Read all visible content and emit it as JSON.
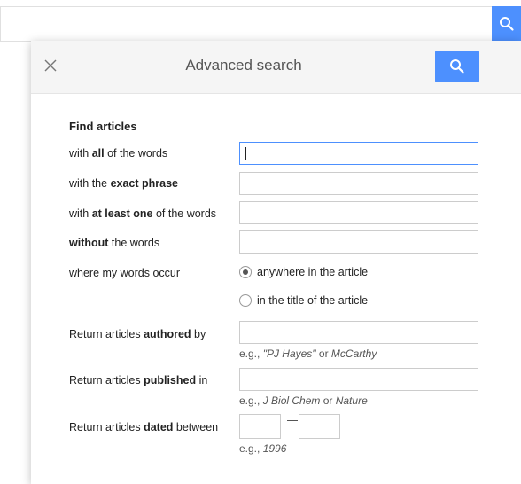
{
  "dialog": {
    "title": "Advanced search"
  },
  "form": {
    "heading": "Find articles",
    "all_words": {
      "pre": "with ",
      "bold": "all",
      "post": " of the words"
    },
    "exact_phrase": {
      "pre": "with the ",
      "bold": "exact phrase",
      "post": ""
    },
    "at_least_one": {
      "pre": "with ",
      "bold": "at least one",
      "post": " of the words"
    },
    "without": {
      "pre": "",
      "bold": "without",
      "post": " the words"
    },
    "where_label": "where my words occur",
    "where_options": [
      "anywhere in the article",
      "in the title of the article"
    ],
    "where_selected": "anywhere in the article",
    "authored": {
      "pre": "Return articles ",
      "bold": "authored",
      "post": " by"
    },
    "authored_hint": {
      "pre": "e.g., ",
      "em1": "\"PJ Hayes\"",
      "mid": " or ",
      "em2": "McCarthy"
    },
    "published": {
      "pre": "Return articles ",
      "bold": "published",
      "post": " in"
    },
    "published_hint": {
      "pre": "e.g., ",
      "em1": "J Biol Chem",
      "mid": " or ",
      "em2": "Nature"
    },
    "dated": {
      "pre": "Return articles ",
      "bold": "dated",
      "post": " between"
    },
    "dated_hint": {
      "pre": "e.g., ",
      "em1": "1996"
    }
  },
  "colors": {
    "accent": "#4d90fe",
    "header_bg": "#f5f5f5"
  },
  "icons": {
    "close": "close-icon",
    "search": "search-icon"
  }
}
